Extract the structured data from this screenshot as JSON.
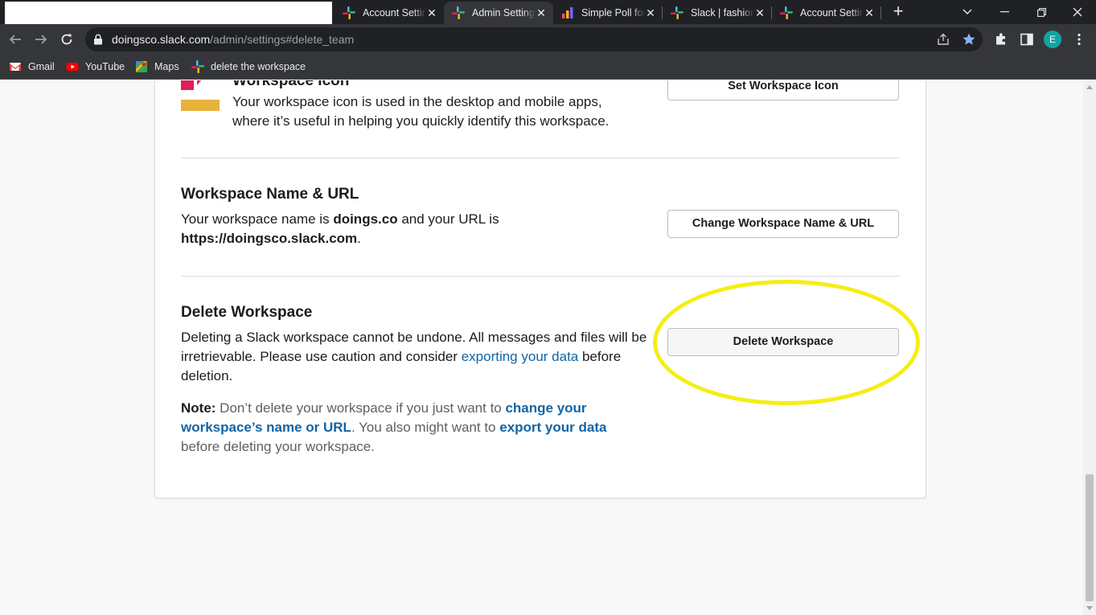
{
  "browser": {
    "tabs": [
      {
        "label": "",
        "active": false
      },
      {
        "label": "Account Settings",
        "active": false
      },
      {
        "label": "Admin Settings",
        "active": true
      },
      {
        "label": "Simple Poll for",
        "active": false
      },
      {
        "label": "Slack | fashion",
        "active": false
      },
      {
        "label": "Account Settings",
        "active": false
      }
    ],
    "new_tab": "+",
    "url_host": "doingsco.slack.com",
    "url_path": "/admin/settings#delete_team",
    "profile_initial": "E",
    "bookmarks": [
      {
        "label": "Gmail",
        "icon": "gmail-icon"
      },
      {
        "label": "YouTube",
        "icon": "youtube-icon"
      },
      {
        "label": "Maps",
        "icon": "maps-icon"
      },
      {
        "label": "delete the workspace",
        "icon": "slack-icon"
      }
    ]
  },
  "settings": {
    "workspace_icon": {
      "title": "Workspace Icon",
      "description": "Your workspace icon is used in the desktop and mobile apps, where it’s useful in helping you quickly identify this workspace.",
      "button": "Set Workspace Icon"
    },
    "name_url": {
      "title": "Workspace Name & URL",
      "text_1": "Your workspace name is ",
      "name": "doings.co",
      "text_2": " and your URL is ",
      "url": "https://doingsco.slack.com",
      "text_3": ".",
      "button": "Change Workspace Name & URL"
    },
    "delete": {
      "title": "Delete Workspace",
      "text_1": "Deleting a Slack workspace cannot be undone. All messages and files will be irretrievable. Please use caution and consider ",
      "link_export": "exporting your data",
      "text_2": " before deletion.",
      "note_label": "Note:",
      "note_1": " Don’t delete your workspace if you just want to ",
      "note_link_change": "change your workspace’s name or URL",
      "note_2": ". You also might want to ",
      "note_link_export": "export your data",
      "note_3": " before deleting your workspace.",
      "button": "Delete Workspace"
    }
  },
  "colors": {
    "highlight": "#f5ee14",
    "link": "#1264a3",
    "chrome_dark": "#202124",
    "chrome_toolbar": "#35363a"
  }
}
